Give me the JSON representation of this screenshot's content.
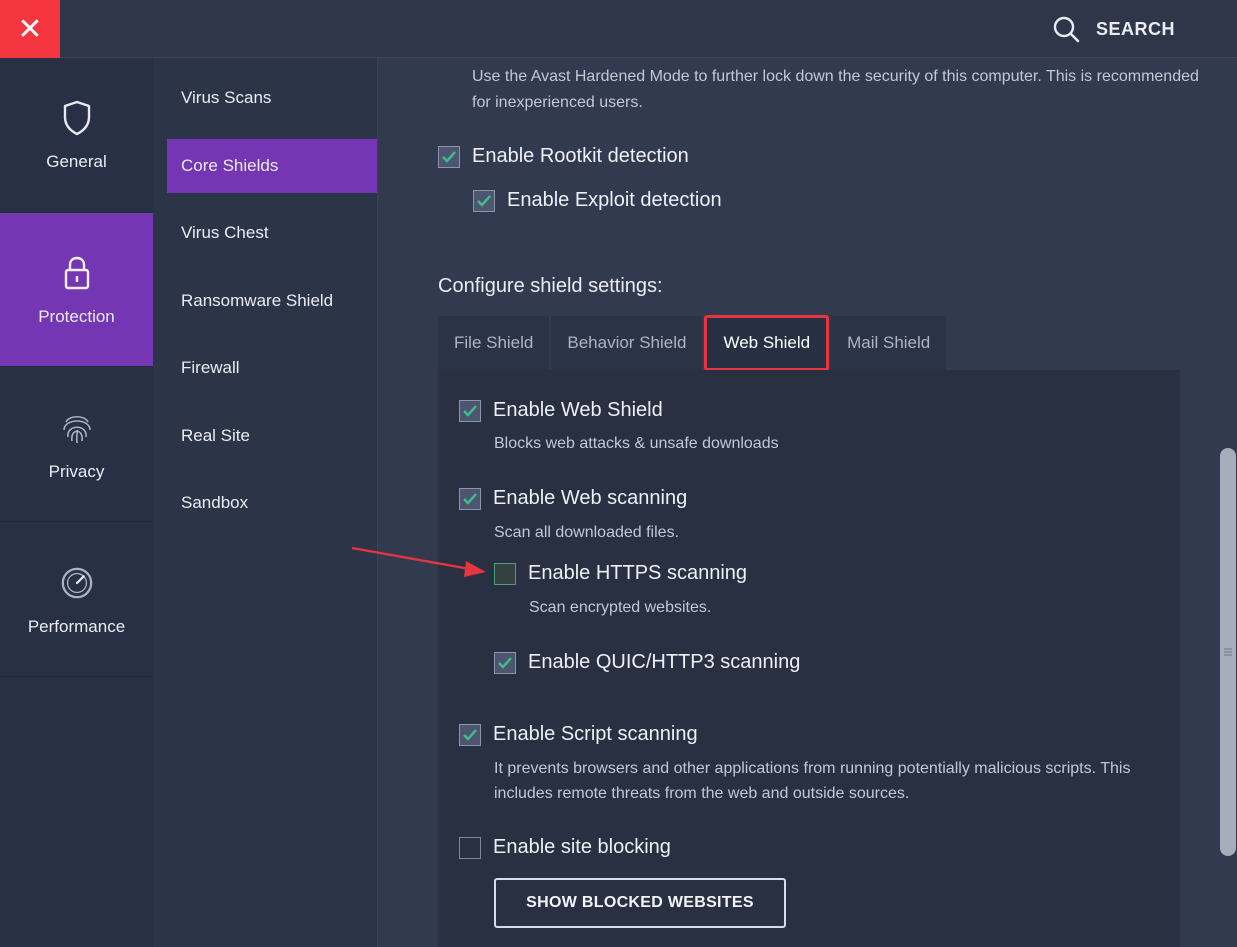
{
  "topbar": {
    "close_symbol": "✕",
    "search_label": "SEARCH"
  },
  "leftnav": {
    "items": [
      {
        "label": "General",
        "icon": "shield-icon"
      },
      {
        "label": "Protection",
        "icon": "lock-icon",
        "active": true
      },
      {
        "label": "Privacy",
        "icon": "fingerprint-icon"
      },
      {
        "label": "Performance",
        "icon": "speedometer-icon"
      }
    ]
  },
  "subnav": {
    "items": [
      {
        "label": "Virus Scans"
      },
      {
        "label": "Core Shields",
        "active": true
      },
      {
        "label": "Virus Chest"
      },
      {
        "label": "Ransomware Shield"
      },
      {
        "label": "Firewall"
      },
      {
        "label": "Real Site"
      },
      {
        "label": "Sandbox"
      }
    ]
  },
  "content": {
    "hardened_desc": "Use the Avast Hardened Mode to further lock down the security of this computer. This is recommended for inexperienced users.",
    "rootkit_label": "Enable Rootkit detection",
    "exploit_label": "Enable Exploit detection",
    "configure_title": "Configure shield settings:",
    "tabs": [
      {
        "label": "File Shield"
      },
      {
        "label": "Behavior Shield"
      },
      {
        "label": "Web Shield",
        "active": true
      },
      {
        "label": "Mail Shield"
      }
    ],
    "web_shield": {
      "enable_label": "Enable Web Shield",
      "enable_desc": "Blocks web attacks & unsafe downloads",
      "scanning_label": "Enable Web scanning",
      "scanning_desc": "Scan all downloaded files.",
      "https_label": "Enable HTTPS scanning",
      "https_desc": "Scan encrypted websites.",
      "quic_label": "Enable QUIC/HTTP3 scanning",
      "script_label": "Enable Script scanning",
      "script_desc": "It prevents browsers and other applications from running potentially malicious scripts. This includes remote threats from the web and outside sources.",
      "site_blocking_label": "Enable site blocking",
      "show_blocked_button": "SHOW BLOCKED WEBSITES"
    }
  },
  "colors": {
    "accent_purple": "#7436b3",
    "close_red": "#f5353f",
    "highlight_red": "#e5353e",
    "check_green": "#3fbf8a"
  }
}
